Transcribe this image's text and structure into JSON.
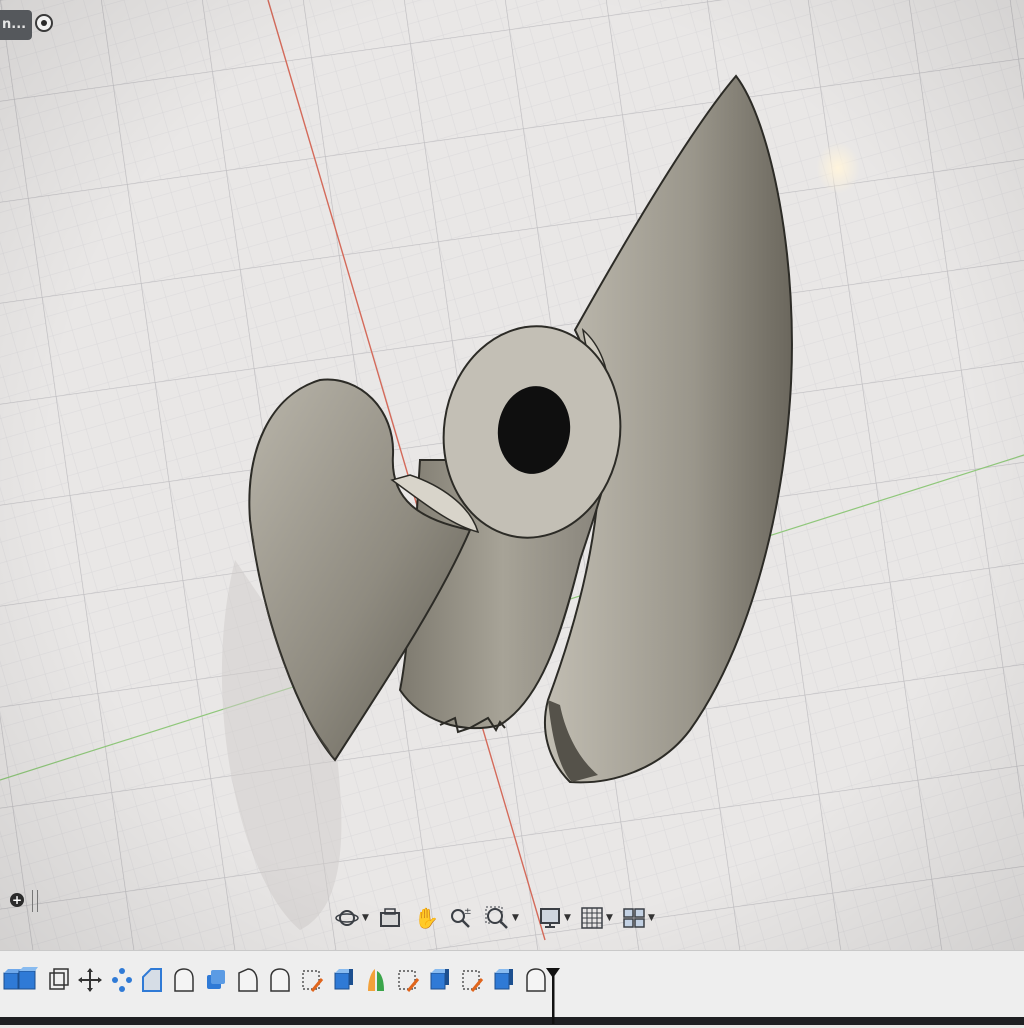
{
  "top_tab": {
    "label": "n..."
  },
  "icons": {
    "top": [
      "target-icon"
    ],
    "left": [
      "add-icon",
      "panel-grip-icon"
    ],
    "navigation": [
      "orbit-icon",
      "look-at-icon",
      "pan-hand-icon",
      "zoom-icon",
      "zoom-window-icon",
      "display-settings-icon",
      "grid-settings-icon",
      "viewports-icon"
    ],
    "timeline": [
      "extrude-feature-icon",
      "sketch-feature-icon",
      "move-feature-icon",
      "pattern-feature-icon",
      "fillet-feature-icon",
      "chamfer-feature-icon",
      "body-feature-icon",
      "loft-feature-icon",
      "plane-feature-icon",
      "sketch-edit-feature-icon",
      "revolve-feature-icon",
      "mirror-feature-icon",
      "sketch-feature-icon",
      "box-feature-icon",
      "sketch-edit-feature-icon",
      "body-feature-icon",
      "hole-feature-icon"
    ]
  },
  "colors": {
    "canvas": "#e9e7e6",
    "grid": "#cfcfd2",
    "x_axis": "#d46a5a",
    "y_axis": "#8fc77a",
    "model": "#a8a499",
    "model_dark": "#6f6b60",
    "accent": "#2f7ad6"
  }
}
